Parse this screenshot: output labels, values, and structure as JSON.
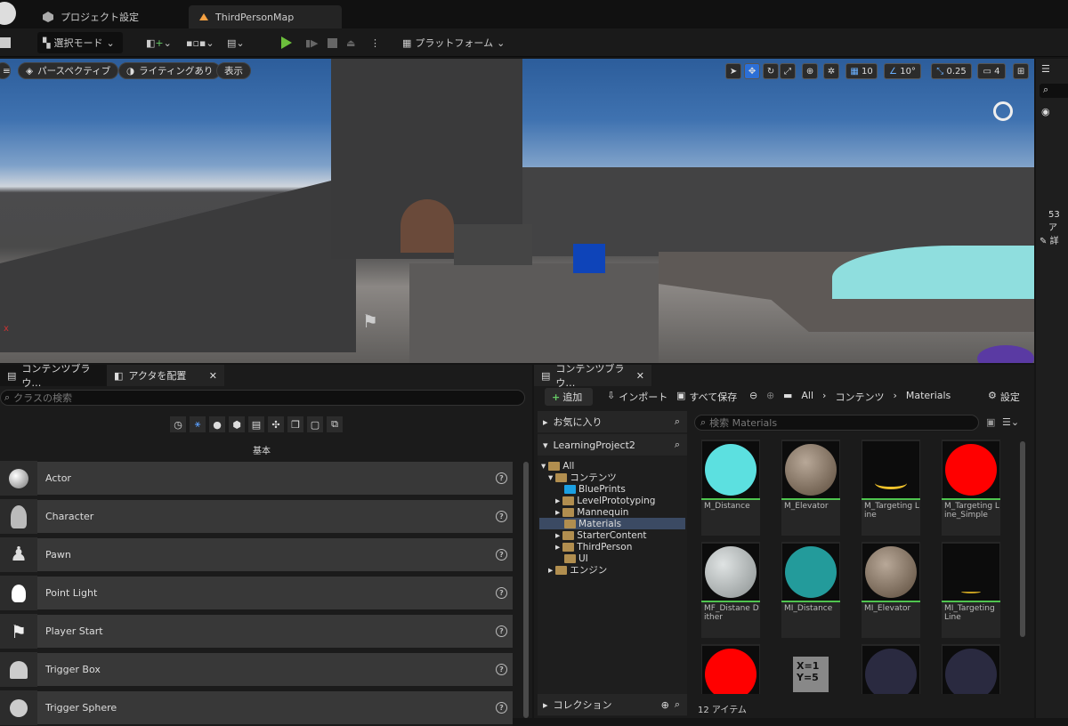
{
  "titlebar": {
    "project_settings": "プロジェクト設定",
    "map_tab": "ThirdPersonMap"
  },
  "toolbar": {
    "select_mode": "選択モード",
    "platform": "プラットフォーム"
  },
  "viewport": {
    "perspective": "パースペクティブ",
    "lighting": "ライティングあり",
    "show": "表示",
    "grid_snap": "10",
    "rot_snap": "10°",
    "scale_snap": "0.25",
    "cam_speed": "4"
  },
  "outliner": {
    "count": "53 ア",
    "details": "詳"
  },
  "left_panel": {
    "tab_content": "コンテンツブラウ…",
    "tab_place": "アクタを配置",
    "search_placeholder": "クラスの検索",
    "category": "基本",
    "items": [
      {
        "label": "Actor"
      },
      {
        "label": "Character"
      },
      {
        "label": "Pawn"
      },
      {
        "label": "Point Light"
      },
      {
        "label": "Player Start"
      },
      {
        "label": "Trigger Box"
      },
      {
        "label": "Trigger Sphere"
      }
    ]
  },
  "content_browser": {
    "tab": "コンテンツブラウ…",
    "add": "追加",
    "import": "インポート",
    "save_all": "すべて保存",
    "crumbs": [
      "All",
      "コンテンツ",
      "Materials"
    ],
    "settings": "設定",
    "favorites": "お気に入り",
    "project": "LearningProject2",
    "tree": [
      {
        "label": "All"
      },
      {
        "label": "コンテンツ"
      },
      {
        "label": "BluePrints"
      },
      {
        "label": "LevelPrototyping"
      },
      {
        "label": "Mannequin"
      },
      {
        "label": "Materials"
      },
      {
        "label": "StarterContent"
      },
      {
        "label": "ThirdPerson"
      },
      {
        "label": "UI"
      },
      {
        "label": "エンジン"
      }
    ],
    "collections": "コレクション",
    "search_placeholder": "検索 Materials",
    "item_count": "12 アイテム",
    "assets": [
      {
        "name": "M_Distance",
        "color": "#5ce0e0"
      },
      {
        "name": "M_Elevator",
        "color": "#8a7a6a"
      },
      {
        "name": "M_Targeting Line",
        "color": "#000000"
      },
      {
        "name": "M_Targeting Line_Simple",
        "color": "#ff0000"
      },
      {
        "name": "MF_Distane Dither",
        "color": "#bfc3c3"
      },
      {
        "name": "MI_Distance",
        "color": "#239b9b"
      },
      {
        "name": "MI_Elevator",
        "color": "#8a7a6a"
      },
      {
        "name": "MI_Targeting Line",
        "color": "#000000"
      },
      {
        "name": "",
        "color": "#ff0000"
      },
      {
        "name": "",
        "color": "#333333"
      },
      {
        "name": "",
        "color": "#2a2a40"
      },
      {
        "name": "",
        "color": "#2a2a40"
      }
    ],
    "xy_label": "X=1\nY=5"
  }
}
